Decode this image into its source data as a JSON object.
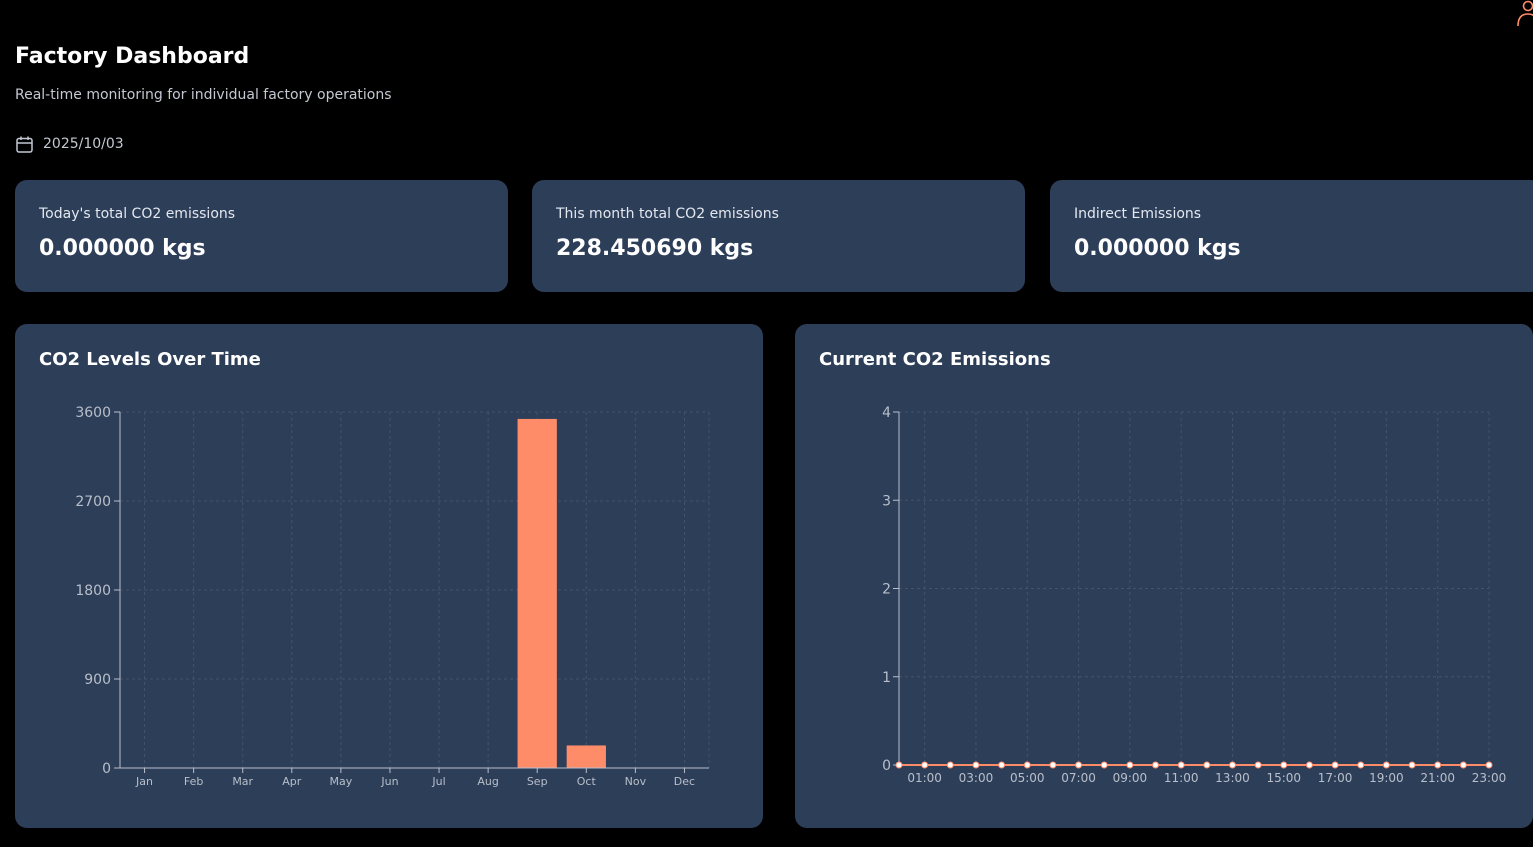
{
  "header": {
    "title": "Factory Dashboard",
    "subtitle": "Real-time monitoring for individual factory operations",
    "date": "2025/10/03",
    "calendar_icon": "calendar-icon",
    "user_icon": "user-icon"
  },
  "colors": {
    "background": "#000000",
    "card": "#2d3e59",
    "accent": "#ff8c69",
    "axis": "#b9bfca"
  },
  "stats": [
    {
      "label": "Today's total CO2 emissions",
      "value": "0.000000 kgs"
    },
    {
      "label": "This month total CO2 emissions",
      "value": "228.450690 kgs"
    },
    {
      "label": "Indirect Emissions",
      "value": "0.000000 kgs"
    }
  ],
  "charts": {
    "levels_title": "CO2 Levels Over Time",
    "current_title": "Current CO2 Emissions"
  },
  "chart_data": [
    {
      "type": "bar",
      "title": "CO2 Levels Over Time",
      "categories": [
        "Jan",
        "Feb",
        "Mar",
        "Apr",
        "May",
        "Jun",
        "Jul",
        "Aug",
        "Sep",
        "Oct",
        "Nov",
        "Dec"
      ],
      "values": [
        0,
        0,
        0,
        0,
        0,
        0,
        0,
        0,
        3530,
        228,
        0,
        0
      ],
      "ylim": [
        0,
        3600
      ],
      "yticks": [
        "0",
        "900",
        "1800",
        "2700",
        "3600"
      ],
      "grid": true,
      "color": "#ff8c69"
    },
    {
      "type": "line",
      "title": "Current CO2 Emissions",
      "x": [
        "00:00",
        "01:00",
        "02:00",
        "03:00",
        "04:00",
        "05:00",
        "06:00",
        "07:00",
        "08:00",
        "09:00",
        "10:00",
        "11:00",
        "12:00",
        "13:00",
        "14:00",
        "15:00",
        "16:00",
        "17:00",
        "18:00",
        "19:00",
        "20:00",
        "21:00",
        "22:00",
        "23:00"
      ],
      "xtick_labels": [
        "01:00",
        "03:00",
        "05:00",
        "07:00",
        "09:00",
        "11:00",
        "13:00",
        "15:00",
        "17:00",
        "19:00",
        "21:00",
        "23:00"
      ],
      "values": [
        0,
        0,
        0,
        0,
        0,
        0,
        0,
        0,
        0,
        0,
        0,
        0,
        0,
        0,
        0,
        0,
        0,
        0,
        0,
        0,
        0,
        0,
        0,
        0
      ],
      "ylim": [
        0,
        4
      ],
      "yticks": [
        "0",
        "1",
        "2",
        "3",
        "4"
      ],
      "grid": true,
      "color": "#ff8c69"
    }
  ]
}
